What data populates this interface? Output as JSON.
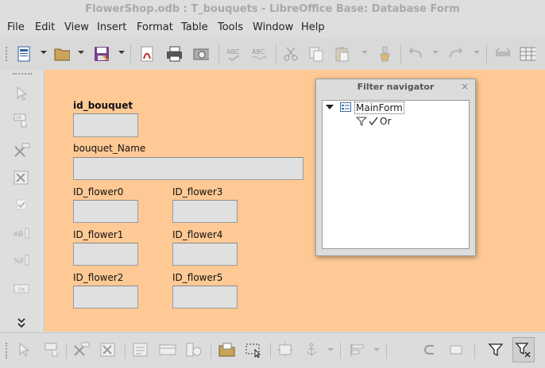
{
  "window": {
    "title": "FlowerShop.odb : T_bouquets - LibreOffice Base: Database Form"
  },
  "menu": [
    "File",
    "Edit",
    "View",
    "Insert",
    "Format",
    "Table",
    "Tools",
    "Window",
    "Help"
  ],
  "form": {
    "labels": {
      "id_bouquet": "id_bouquet",
      "bouquet_name": "bouquet_Name",
      "id_flower0": "ID_flower0",
      "id_flower1": "ID_flower1",
      "id_flower2": "ID_flower2",
      "id_flower3": "ID_flower3",
      "id_flower4": "ID_flower4",
      "id_flower5": "ID_flower5"
    }
  },
  "filter_navigator": {
    "title": "Filter navigator",
    "close": "×",
    "root_label": "MainForm",
    "child_label": "Or"
  },
  "colors": {
    "form_background": "#fec994",
    "toolbar_background": "#dcdcdc",
    "field_background": "#e0e0e0",
    "title_text": "#a9a9a9"
  },
  "icons": {
    "left_toolbar": [
      "pointer-icon",
      "push-button-icon",
      "design-mode-icon",
      "control-properties-icon",
      "check-box-icon",
      "label-field-icon",
      "formatted-field-icon",
      "ok-button-icon",
      "more-controls-icon"
    ],
    "bottom_toolbar": [
      "select-icon",
      "push-button-icon",
      "design-mode-icon",
      "control-properties-icon",
      "form-properties-icon",
      "form-navigator-icon",
      "activation-order-icon",
      "open-design-mode-icon",
      "select-box-icon",
      "position-size-icon",
      "anchor-icon",
      "align-icon",
      "group-icon",
      "ungroup-icon",
      "auto-filter-icon",
      "apply-filter-icon"
    ]
  }
}
